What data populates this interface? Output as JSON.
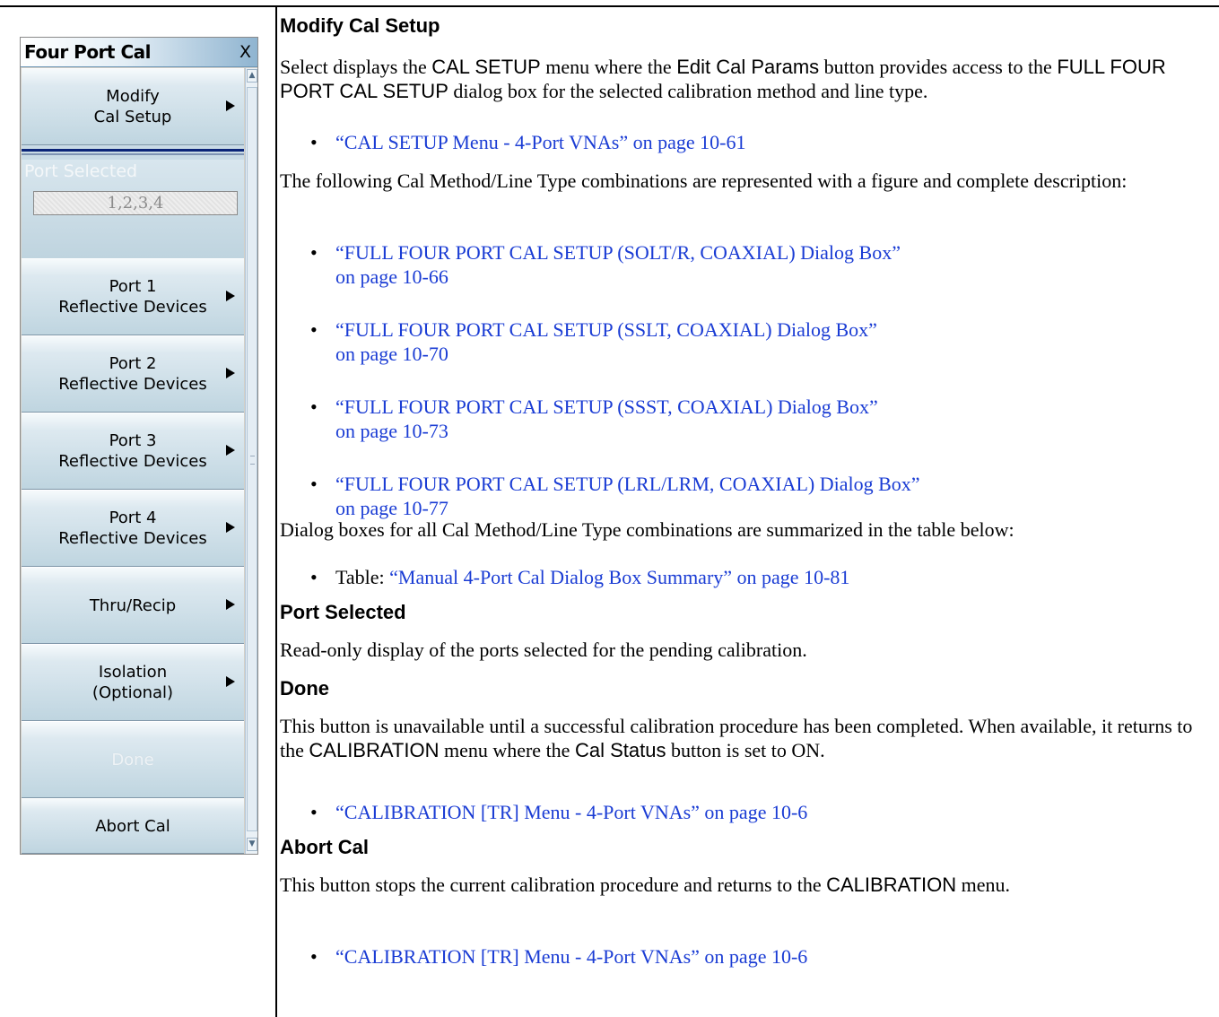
{
  "menu": {
    "title": "Four Port Cal",
    "close": "X",
    "modify_cal_setup": "Modify\nCal Setup",
    "port_selected_label": "Port Selected",
    "port_selected_value": "1,2,3,4",
    "port1": "Port 1\nReflective Devices",
    "port2": "Port 2\nReflective Devices",
    "port3": "Port 3\nReflective Devices",
    "port4": "Port 4\nReflective Devices",
    "thru_recip": "Thru/Recip",
    "isolation": "Isolation\n(Optional)",
    "done": "Done",
    "abort_cal": "Abort Cal"
  },
  "doc": {
    "s1_heading": "Modify Cal Setup",
    "s1_p1": [
      "Select displays the ",
      "CAL SETUP",
      " menu where the ",
      "Edit Cal Params",
      " button provides access to the ",
      "FULL FOUR PORT CAL SETUP",
      " dialog box for the selected calibration method and line type."
    ],
    "s1_link1": "“CAL SETUP Menu - 4-Port VNAs” on page 10-61",
    "s1_p2": "The following Cal Method/Line Type combinations are represented with a figure and complete description:",
    "s1_links": [
      [
        "“FULL FOUR PORT CAL SETUP (SOLT/R, COAXIAL) Dialog Box”",
        "on page 10-66"
      ],
      [
        "“FULL FOUR PORT CAL SETUP (SSLT, COAXIAL) Dialog Box”",
        "on page 10-70"
      ],
      [
        "“FULL FOUR PORT CAL SETUP (SSST, COAXIAL) Dialog Box”",
        "on page 10-73"
      ],
      [
        "“FULL FOUR PORT CAL SETUP (LRL/LRM, COAXIAL) Dialog Box”",
        "on page 10-77"
      ]
    ],
    "s1_p3": "Dialog boxes for all Cal Method/Line Type combinations are summarized in the table below:",
    "s1_table_prefix": "Table: ",
    "s1_table_link": "“Manual 4-Port Cal Dialog Box Summary” on page 10-81",
    "s2_heading": "Port Selected",
    "s2_p": "Read-only display of the ports selected for the pending calibration.",
    "s3_heading": "Done",
    "s3_p": [
      "This button is unavailable until a successful calibration procedure has been completed. When available, it returns to the ",
      "CALIBRATION",
      " menu where the ",
      "Cal Status",
      " button is set to ON."
    ],
    "s3_link": "“CALIBRATION [TR] Menu - 4-Port VNAs” on page 10-6",
    "s4_heading": "Abort Cal",
    "s4_p": [
      "This button stops the current calibration procedure and returns to the ",
      "CALIBRATION",
      " menu."
    ],
    "s4_link": "“CALIBRATION [TR] Menu - 4-Port VNAs” on page 10-6",
    "bullet": "•"
  },
  "colors": {
    "link": "#1a3cd4",
    "menu_title_gradient_end": "#8fb4d0",
    "separator": "#0a2478"
  }
}
